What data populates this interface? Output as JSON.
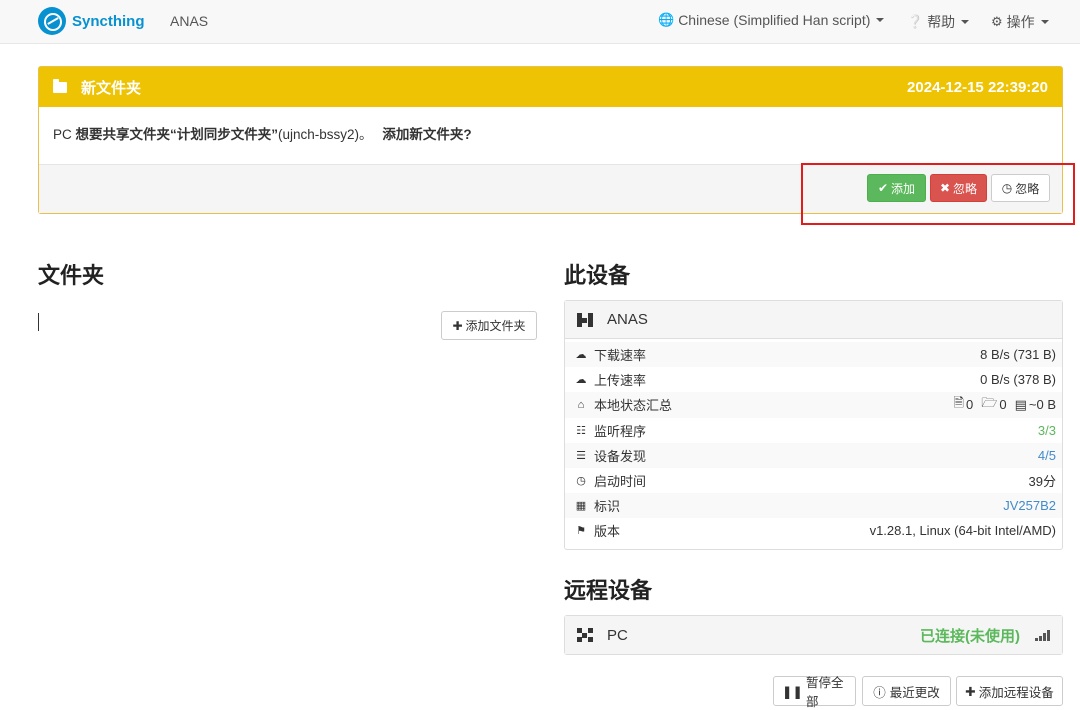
{
  "navbar": {
    "brand": "Syncthing",
    "device": "ANAS",
    "language": "Chinese (Simplified Han script)",
    "help": "帮助",
    "actions": "操作"
  },
  "notice": {
    "title": "新文件夹",
    "timestamp": "2024-12-15 22:39:20",
    "message_device": "PC",
    "message_wants": "想要共享文件夹",
    "message_folder": "“计划同步文件夹”",
    "message_id": "(ujnch-bssy2)。",
    "message_question": "添加新文件夹?",
    "btn_add": "添加",
    "btn_ignore": "忽略",
    "btn_later": "忽略"
  },
  "folders": {
    "heading": "文件夹",
    "add_button": "添加文件夹"
  },
  "this_device": {
    "heading": "此设备",
    "name": "ANAS",
    "rows": [
      {
        "label": "下载速率",
        "value": "8 B/s (731 B)"
      },
      {
        "label": "上传速率",
        "value": "0 B/s (378 B)"
      },
      {
        "label": "本地状态汇总",
        "files": "0",
        "dirs": "0",
        "size": "~0 B"
      },
      {
        "label": "监听程序",
        "value": "3/3"
      },
      {
        "label": "设备发现",
        "value": "4/5"
      },
      {
        "label": "启动时间",
        "value": "39分"
      },
      {
        "label": "标识",
        "value": "JV257B2"
      },
      {
        "label": "版本",
        "value": "v1.28.1, Linux (64-bit Intel/AMD)"
      }
    ]
  },
  "remote": {
    "heading": "远程设备",
    "name": "PC",
    "status": "已连接(未使用)"
  },
  "bottom_buttons": {
    "pause_all": "暂停全部",
    "recent_changes": "最近更改",
    "add_remote": "添加远程设备"
  },
  "colors": {
    "brand": "#0891d1",
    "notice_header": "#eec303",
    "success": "#5cb85c",
    "danger": "#d9534f",
    "link": "#428bca"
  }
}
